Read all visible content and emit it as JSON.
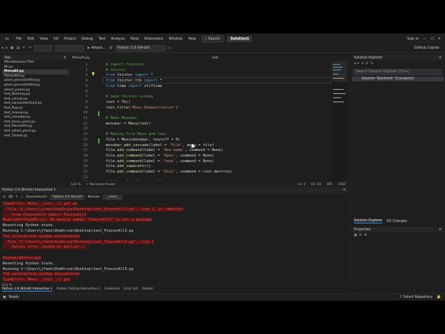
{
  "menu": {
    "items": [
      "File",
      "Edit",
      "View",
      "Git",
      "Project",
      "Debug",
      "Test",
      "Analyze",
      "Tools",
      "Extensions",
      "Window",
      "Help"
    ],
    "search": "Search",
    "solution": "Solution1",
    "sign_in": "Sign in"
  },
  "toolbar": {
    "attach": "Attach...",
    "env": "Python 3.9 (64-bit)",
    "copilot": "GitHub Copilot"
  },
  "left_pane": {
    "title": "Tabs",
    "section": "Miscellaneous Files",
    "files": [
      "Bk.py",
      "MenuAll.py",
      "PiecesAll3.py",
      "place_piecesUnified.py",
      "place_piecesUnified.py",
      "select_pieces.py",
      "test_Board.py.py",
      "test_canvas.py",
      "test_canvaselection2.py",
      "test_ftyp.py",
      "test_manual.py",
      "test_menubar.py",
      "test_move_piece.py",
      "test_PiecesAll3.py",
      "test_select_piece.py",
      "test_Tkinter.py"
    ],
    "selected_index": 1
  },
  "editor": {
    "tab": "MenuAll.py",
    "breadcrumb": "root",
    "lines": [
      {
        "n": "1",
        "html": "<span class=\"cm\"># import functons</span>"
      },
      {
        "n": "2",
        "html": "<span class=\"cm\"># tkinter</span>"
      },
      {
        "n": "3",
        "html": "<span class=\"kw\">from</span> tkinter <span class=\"kw\">import</span> *"
      },
      {
        "n": "4",
        "html": "<span class=\"kw\">from</span> tkinter.ttk <span class=\"kw\">import</span> *"
      },
      {
        "n": "5",
        "html": "<span class=\"kw\">from</span> time <span class=\"kw\">import</span> strftime"
      },
      {
        "n": "6",
        "html": ""
      },
      {
        "n": "7",
        "html": "<span class=\"cm\"># make tkinter window</span>"
      },
      {
        "n": "8",
        "html": "root = <span class=\"fn\">Tk</span>()"
      },
      {
        "n": "9",
        "html": "root.<span class=\"fn\">title</span>(<span class=\"st\">'Menu Demonstration'</span>)"
      },
      {
        "n": "10",
        "html": ""
      },
      {
        "n": "11",
        "html": "<span class=\"cm\"># Make Menubar</span>"
      },
      {
        "n": "12",
        "html": "menubar = <span class=\"fn\">Menu</span>(root)"
      },
      {
        "n": "13",
        "html": ""
      },
      {
        "n": "14",
        "html": "<span class=\"cm\"># Making File Menu and tabs</span>"
      },
      {
        "n": "15",
        "html": "file = <span class=\"fn\">Menu</span>(menubar, tearoff = 0)"
      },
      {
        "n": "16",
        "html": "menubar.<span class=\"fn\">add_cascade</span>(label = <span class=\"st\">'File'</span>, menu = file)"
      },
      {
        "n": "17",
        "html": "file.<span class=\"fn\">add_command</span>(label = <span class=\"st\">'New Game'</span>, command = None)"
      },
      {
        "n": "18",
        "html": "file.<span class=\"fn\">add_command</span>(label = <span class=\"st\">'Open'</span>, command = None)"
      },
      {
        "n": "19",
        "html": "file.<span class=\"fn\">add_command</span>(label = <span class=\"st\">'Save'</span>, command = None)"
      },
      {
        "n": "20",
        "html": "file.<span class=\"fn\">add_separator</span>()"
      },
      {
        "n": "21",
        "html": "file.<span class=\"fn\">add_command</span>(label = <span class=\"st\">'Exit'</span>, command = root.destroy)"
      },
      {
        "n": "22",
        "html": ""
      },
      {
        "n": "23",
        "html": "<span class=\"cm\"># Adding Edit Menu and Other tabs</span>"
      }
    ],
    "status": {
      "zoom": "121 %",
      "issues": "No issues found",
      "ln": "Ln: 3",
      "ch": "Ch: 23",
      "enc": "SPC",
      "eol": "CRLF"
    }
  },
  "interactive": {
    "title": "Python 3.9 (64-bit) Interactive 1",
    "environment_label": "Environment:",
    "environment": "Python 3.9 (64-bit)",
    "module_label": "Module:",
    "module": "__main__",
    "lines": [
      {
        "cls": "err",
        "text": "TypeError: Menu.__init__() got an"
      },
      {
        "cls": "err",
        "text": "  File \"C:\\Users\\jfann\\OneDrive\\Desktop\\test_PiecesAll3.py\", line 1, in <module>"
      },
      {
        "cls": "err",
        "text": "    from PiecesAll3 import PiecesAll3"
      },
      {
        "cls": "err",
        "text": "ModuleNotFoundError: No module named 'PiecesAll3' in not a package"
      },
      {
        "cls": "norm",
        "text": "Resetting Python state."
      },
      {
        "cls": "norm",
        "text": "Running C:\\Users\\jfann\\OneDrive\\Desktop\\test_PiecesAll3.py"
      },
      {
        "cls": "err",
        "text": "The interactive window encountered"
      },
      {
        "cls": "err",
        "text": "  File \"C:\\Users\\jfann\\OneDrive\\Desktop\\test_PiecesAll3.py\", line 1"
      },
      {
        "cls": "err",
        "text": "    Syntax error caused by earlier..."
      },
      {
        "cls": "norm",
        "text": ""
      },
      {
        "cls": "err",
        "text": "KeyboardInterrupt"
      },
      {
        "cls": "norm",
        "text": "Resetting Python state."
      },
      {
        "cls": "norm",
        "text": "Running C:\\Users\\jfann\\OneDrive\\Desktop\\test_PiecesAll3.py"
      },
      {
        "cls": "err",
        "text": "The interactive window encountered"
      },
      {
        "cls": "err",
        "text": "TypeError: Menu.__init__() got"
      }
    ],
    "zoom": "121 %",
    "tabs": [
      "Python 3.9 (64-bit) Interactive 1",
      "Python Testing Interactive 2",
      "CodeLens",
      "Error List",
      "Output"
    ]
  },
  "right_pane": {
    "title": "Solution Explorer",
    "search_placeholder": "Search Solution Explorer (Ctrl+;)",
    "solution_item": "Solution 'Solution1' (0 projects)",
    "tabs": [
      "Solution Explorer",
      "Git Changes"
    ],
    "properties_title": "Properties"
  },
  "statusbar": {
    "ready": "Ready",
    "repo": "Select Repository"
  }
}
